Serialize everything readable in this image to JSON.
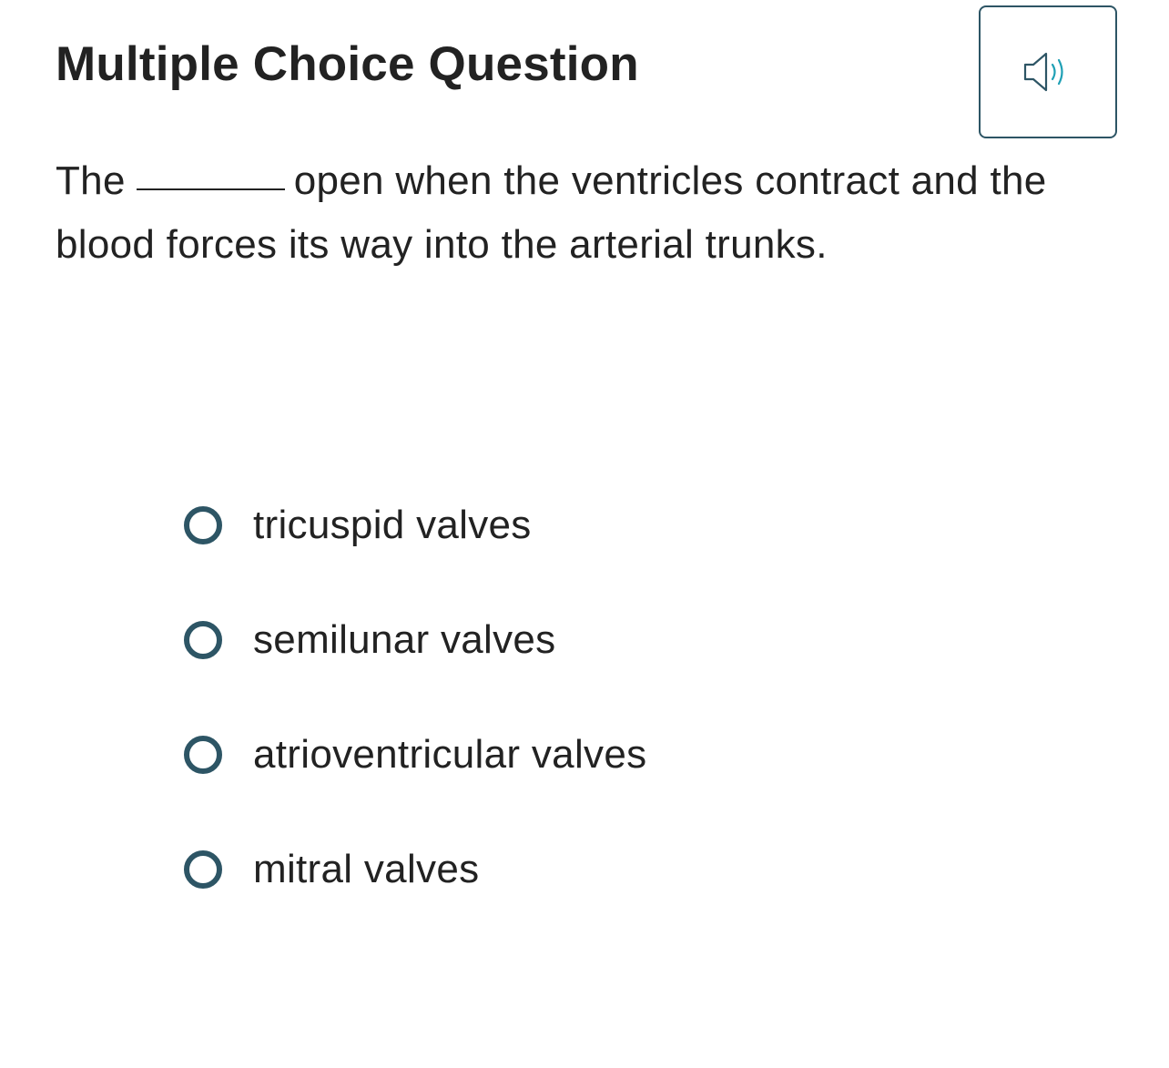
{
  "header": {
    "title": "Multiple Choice Question",
    "audio_icon": "speaker-volume-icon",
    "accent_color": "#2d5565",
    "audio_wave_color": "#1fa0b5"
  },
  "question": {
    "text_before": "The",
    "text_after": "open when the ventricles contract and the blood forces its way into the arterial trunks."
  },
  "options": [
    {
      "label": "tricuspid valves"
    },
    {
      "label": "semilunar valves"
    },
    {
      "label": "atrioventricular valves"
    },
    {
      "label": "mitral valves"
    }
  ]
}
